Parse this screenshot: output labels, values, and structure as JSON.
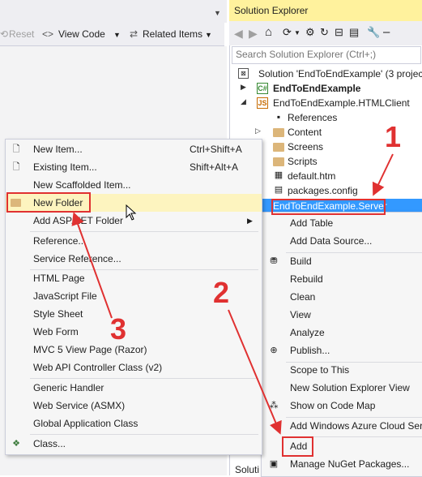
{
  "editor": {
    "toolbar": {
      "reset_label": "Reset",
      "write_code_label": "View Code",
      "related_items_label": "Related Items"
    }
  },
  "solution_explorer": {
    "title": "Solution Explorer",
    "search_placeholder": "Search Solution Explorer (Ctrl+;)",
    "tree": [
      {
        "label": "Solution 'EndToEndExample' (3 projec"
      },
      {
        "label": "EndToEndExample"
      },
      {
        "label": "EndToEndExample.HTMLClient"
      },
      {
        "label": "References"
      },
      {
        "label": "Content"
      },
      {
        "label": "Screens"
      },
      {
        "label": "Scripts"
      },
      {
        "label": "default.htm"
      },
      {
        "label": "packages.config"
      },
      {
        "label": "EndToEndExample.Server"
      }
    ],
    "bottom_cut_label": "Soluti"
  },
  "project_menu": {
    "items": [
      {
        "label": "Add Table"
      },
      {
        "label": "Add Data Source..."
      },
      {
        "label": "Build"
      },
      {
        "label": "Rebuild"
      },
      {
        "label": "Clean"
      },
      {
        "label": "View"
      },
      {
        "label": "Analyze"
      },
      {
        "label": "Publish..."
      },
      {
        "label": "Scope to This"
      },
      {
        "label": "New Solution Explorer View"
      },
      {
        "label": "Show on Code Map"
      },
      {
        "label": "Add Windows Azure Cloud Ser"
      },
      {
        "label": "Add"
      },
      {
        "label": "Manage NuGet Packages..."
      }
    ]
  },
  "add_menu": {
    "items": [
      {
        "label": "New Item...",
        "shortcut": "Ctrl+Shift+A"
      },
      {
        "label": "Existing Item...",
        "shortcut": "Shift+Alt+A"
      },
      {
        "label": "New Scaffolded Item..."
      },
      {
        "label": "New Folder"
      },
      {
        "label": "Add ASP.NET Folder"
      },
      {
        "label": "Reference..."
      },
      {
        "label": "Service Reference..."
      },
      {
        "label": "HTML Page"
      },
      {
        "label": "JavaScript File"
      },
      {
        "label": "Style Sheet"
      },
      {
        "label": "Web Form"
      },
      {
        "label": "MVC 5 View Page (Razor)"
      },
      {
        "label": "Web API Controller Class (v2)"
      },
      {
        "label": "Generic Handler"
      },
      {
        "label": "Web Service (ASMX)"
      },
      {
        "label": "Global Application Class"
      },
      {
        "label": "Class..."
      }
    ]
  },
  "annotations": {
    "step1": "1",
    "step2": "2",
    "step3": "3"
  },
  "colors": {
    "annotation": "#e03131",
    "selection": "#3399ff",
    "title_bar_active": "#fff29d"
  }
}
